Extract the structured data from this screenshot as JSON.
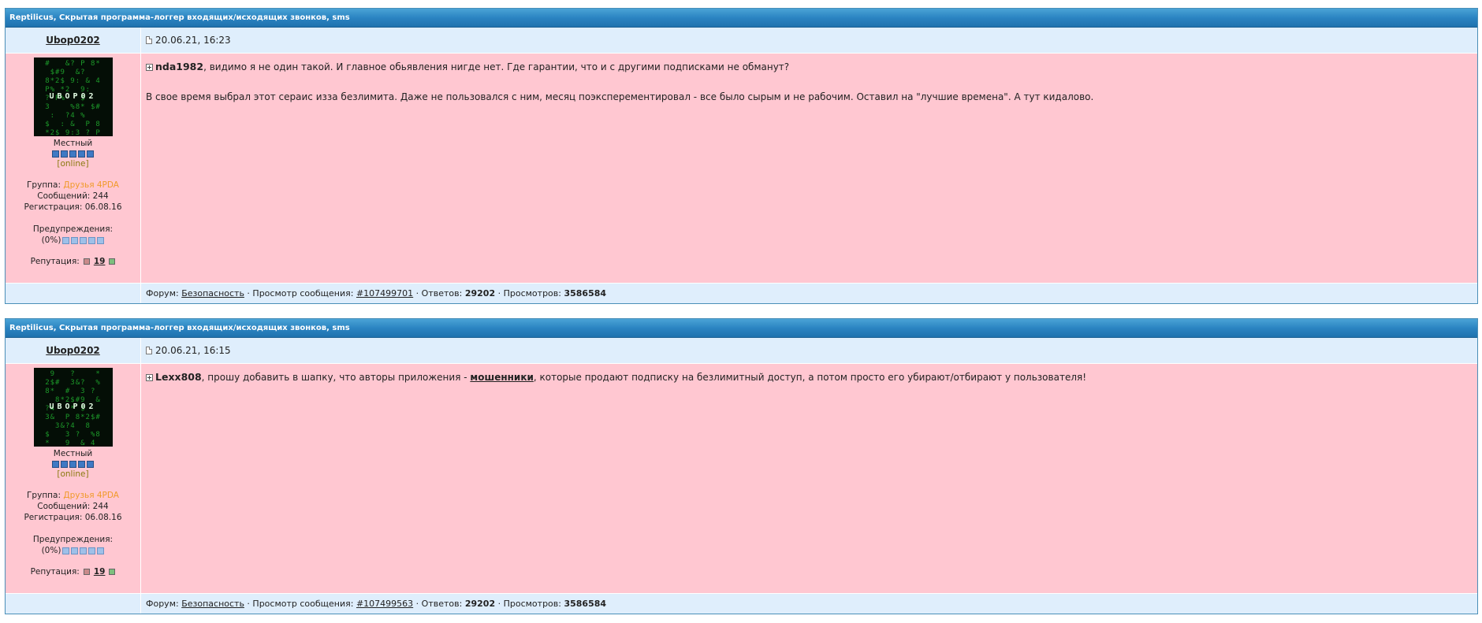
{
  "posts": [
    {
      "topic": "Reptilicus, Скрытая программа-логгер входящих/исходящих звонков, sms",
      "author": "Ubop0202",
      "date": "20.06.21, 16:23",
      "avatar_nick": "UBOP02",
      "rank": "Местный",
      "status": "[online]",
      "group_label": "Группа:",
      "group_value": "Друзья 4PDA",
      "messages": "Сообщений: 244",
      "registered": "Регистрация: 06.08.16",
      "warnings_label": "Предупреждения:",
      "warnings_value": "(0%)",
      "reputation_label": "Репутация:",
      "reputation_value": "19",
      "quote_name": "nda1982",
      "text_1a": ", видимо я не один такой. И главное обьявления нигде нет. Где гарантии, что и с другими подписками не обманут?",
      "text_2": "В свое время выбрал этот сераис изза безлимита. Даже не пользовался с ним, месяц поэксперементировал - все было сырым и не рабочим. Оставил на \"лучшие времена\". А тут кидалово.",
      "footer": {
        "forum_label": "Форум: ",
        "forum_link": "Безопасность",
        "view_label": " · Просмотр сообщения: ",
        "view_link": "#107499701",
        "replies_label": " · Ответов: ",
        "replies": "29202",
        "views_label": " · Просмотров: ",
        "views": "3586584"
      }
    },
    {
      "topic": "Reptilicus, Скрытая программа-логгер входящих/исходящих звонков, sms",
      "author": "Ubop0202",
      "date": "20.06.21, 16:15",
      "avatar_nick": "UBOP02",
      "rank": "Местный",
      "status": "[online]",
      "group_label": "Группа:",
      "group_value": "Друзья 4PDA",
      "messages": "Сообщений: 244",
      "registered": "Регистрация: 06.08.16",
      "warnings_label": "Предупреждения:",
      "warnings_value": "(0%)",
      "reputation_label": "Репутация:",
      "reputation_value": "19",
      "quote_name": "Lexx808",
      "text_1a": ", прошу добавить в шапку, что авторы приложения - ",
      "text_1b": "мошенники",
      "text_1c": ", которые продают подписку на безлимитный доступ, а потом просто его убирают/отбирают у пользователя!",
      "footer": {
        "forum_label": "Форум: ",
        "forum_link": "Безопасность",
        "view_label": " · Просмотр сообщения: ",
        "view_link": "#107499563",
        "replies_label": " · Ответов: ",
        "replies": "29202",
        "views_label": " · Просмотров: ",
        "views": "3586584"
      }
    }
  ]
}
